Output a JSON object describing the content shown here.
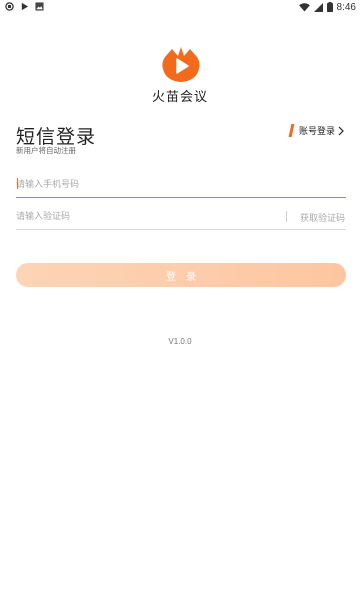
{
  "status_bar": {
    "time": "8:46",
    "left_icons": [
      "message-circle-icon",
      "play-store-icon",
      "photo-icon"
    ],
    "right_icons": [
      "wifi-icon",
      "signal-icon",
      "battery-icon"
    ]
  },
  "app": {
    "name": "火苗会议",
    "logo_icon": "flame-play-logo",
    "brand_color": "#F26B1D"
  },
  "header": {
    "title": "短信登录",
    "subtitle": "新用户将自动注册",
    "switch_label": "账号登录"
  },
  "form": {
    "phone_placeholder": "请输入手机号码",
    "phone_value": "",
    "code_placeholder": "请输入验证码",
    "code_value": "",
    "get_code_label": "获取验证码"
  },
  "login_button": {
    "label": "登录",
    "enabled": false
  },
  "footer": {
    "version": "V1.0.0"
  },
  "colors": {
    "accent": "#F26B1D",
    "button_start": "#FDD4B6",
    "button_end": "#FDC6A1",
    "placeholder": "#AAAAAA"
  }
}
